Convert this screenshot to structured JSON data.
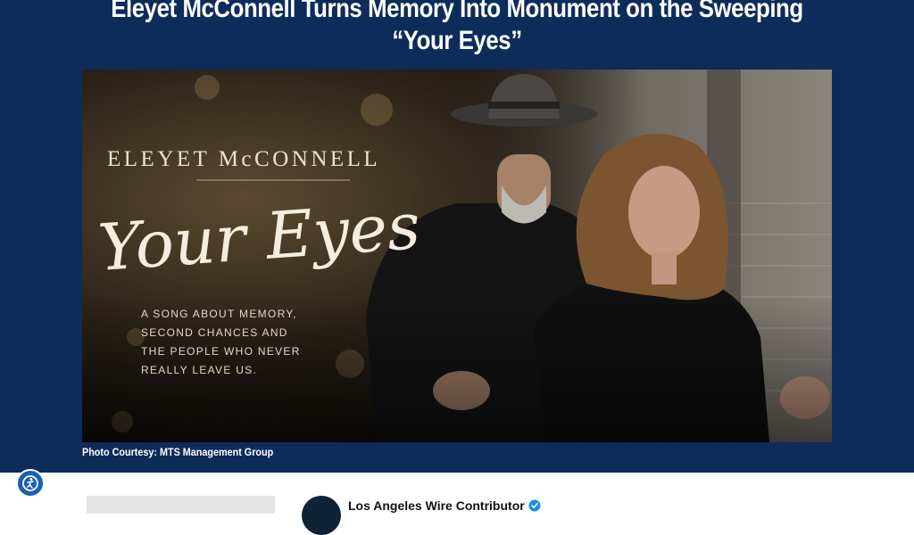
{
  "article": {
    "headline": "Eleyet McConnell Turns Memory Into Monument on the Sweeping “Your Eyes”",
    "photo_caption": "Photo Courtesy: MTS Management Group"
  },
  "cover_art": {
    "artist": "ELEYET McCONNELL",
    "title": "Your Eyes",
    "tagline_lines": [
      "A SONG ABOUT MEMORY,",
      "SECOND CHANCES AND",
      "THE PEOPLE WHO NEVER",
      "REALLY LEAVE US."
    ]
  },
  "author": {
    "name": "Los Angeles Wire Contributor",
    "verified": true
  },
  "colors": {
    "header_bg": "#0d2c5a",
    "accessibility_button": "#1a5fb4",
    "verified_badge": "#1d8df0"
  },
  "icons": {
    "accessibility": "accessibility-icon",
    "verified": "verified-check-icon"
  }
}
